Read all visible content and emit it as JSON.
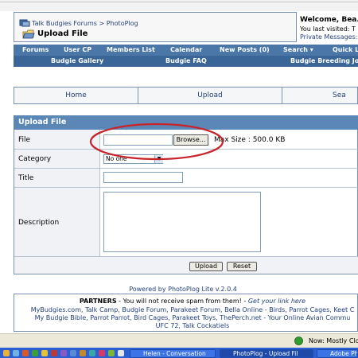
{
  "header": {
    "breadcrumb_site": "Talk Budgies Forums",
    "breadcrumb_sep": ">",
    "breadcrumb_section": "PhotoPlog",
    "page_title": "Upload File",
    "welcome": "Welcome, Bea.",
    "last_visited": "You last visited: T",
    "private_messages": "Private Messages:"
  },
  "nav": {
    "row1": [
      "Forums",
      "User CP",
      "Members List",
      "Calendar",
      "New Posts (0)",
      "Search ▾",
      "Quick Li"
    ],
    "row2": [
      "Budgie Gallery",
      "Budgie FAQ",
      "Budgie Breeding Journ"
    ]
  },
  "tabs": [
    "Home",
    "Upload",
    "Sea"
  ],
  "form": {
    "section_title": "Upload File",
    "file_label": "File",
    "browse_label": "Browse...",
    "max_size": "Max Size : 500.0 KB",
    "category_label": "Category",
    "category_value": "No one",
    "title_label": "Title",
    "title_value": "",
    "description_label": "Description",
    "description_value": "",
    "upload_button": "Upload",
    "reset_button": "Reset"
  },
  "footer": {
    "powered_by": "Powered by PhotoPlog Lite v.2.0.4",
    "partners_heading": "PARTNERS",
    "partners_note": " - You will not receive spam from them! - ",
    "partners_link": "Get your link here",
    "partners_line2": "MyBudgies.com, Talk Camp, Budgie Forum, Parakeet Forum, Bella Online - Birds, Parrot Cages, Keet C",
    "partners_line3": "My Budgie Bible, Parrot Parrot, Bird Cages, Parakeet Toys, ThePerch.net - Your Online Avian Commu",
    "partners_line4": "UFC 72, Talk Cockatiels"
  },
  "status": {
    "weather": "Now: Mostly Cloud"
  },
  "taskbar": {
    "items": [
      "Helen - Conversation",
      "PhotoPlog - Upload Fil",
      "Adobe Pho"
    ]
  },
  "colors": {
    "nav_blue": "#4a77a8",
    "panel_head": "#5b87b6",
    "link_blue": "#24417a",
    "annotation_red": "#c8232b"
  }
}
